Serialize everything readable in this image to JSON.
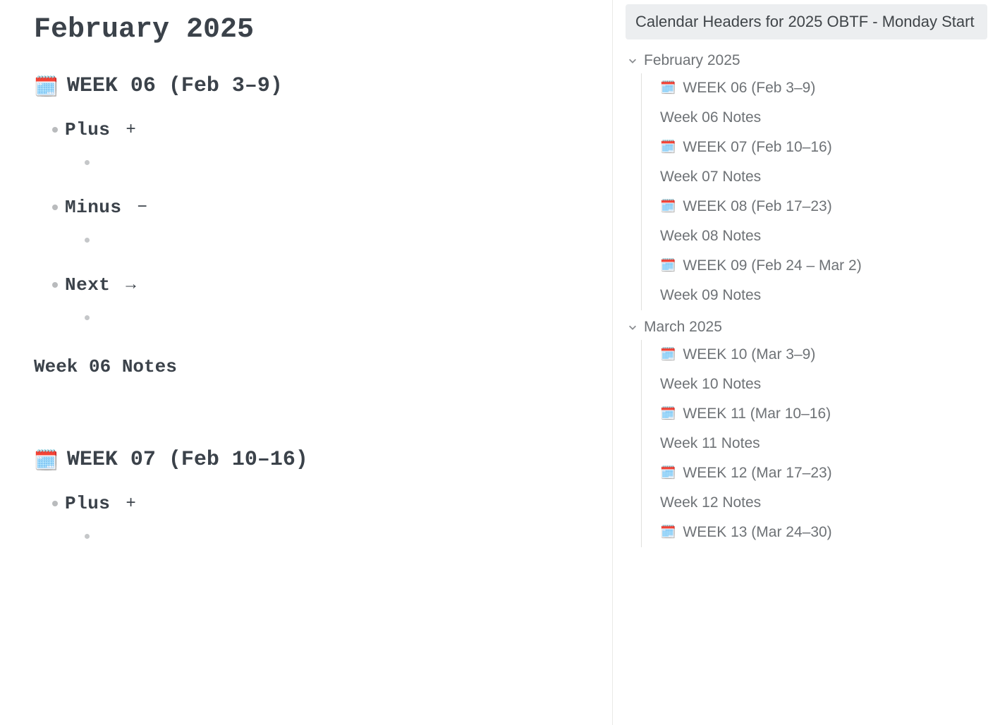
{
  "main": {
    "month_heading": "February 2025",
    "week1": {
      "emoji": "🗓️",
      "title": "WEEK 06 (Feb 3–9)",
      "items": [
        {
          "label": "Plus",
          "symbol": "+"
        },
        {
          "label": "Minus",
          "symbol": "−"
        },
        {
          "label": "Next",
          "symbol": "→"
        }
      ],
      "notes_heading": "Week 06 Notes"
    },
    "week2": {
      "emoji": "🗓️",
      "title": "WEEK 07 (Feb 10–16)",
      "items": [
        {
          "label": "Plus",
          "symbol": "+"
        }
      ]
    }
  },
  "sidebar": {
    "title": "Calendar Headers for 2025 OBTF - Monday Start",
    "sections": [
      {
        "label": "February 2025",
        "items": [
          {
            "emoji": "🗓️",
            "label": "WEEK 06 (Feb 3–9)"
          },
          {
            "label": "Week 06 Notes"
          },
          {
            "emoji": "🗓️",
            "label": "WEEK 07 (Feb 10–16)"
          },
          {
            "label": "Week 07 Notes"
          },
          {
            "emoji": "🗓️",
            "label": "WEEK 08 (Feb 17–23)"
          },
          {
            "label": "Week 08 Notes"
          },
          {
            "emoji": "🗓️",
            "label": "WEEK 09 (Feb 24 – Mar 2)"
          },
          {
            "label": "Week 09 Notes"
          }
        ]
      },
      {
        "label": "March 2025",
        "items": [
          {
            "emoji": "🗓️",
            "label": "WEEK 10 (Mar 3–9)"
          },
          {
            "label": "Week 10 Notes"
          },
          {
            "emoji": "🗓️",
            "label": "WEEK 11 (Mar 10–16)"
          },
          {
            "label": "Week 11 Notes"
          },
          {
            "emoji": "🗓️",
            "label": "WEEK 12 (Mar 17–23)"
          },
          {
            "label": "Week 12 Notes"
          },
          {
            "emoji": "🗓️",
            "label": "WEEK 13 (Mar 24–30)"
          }
        ]
      }
    ]
  }
}
